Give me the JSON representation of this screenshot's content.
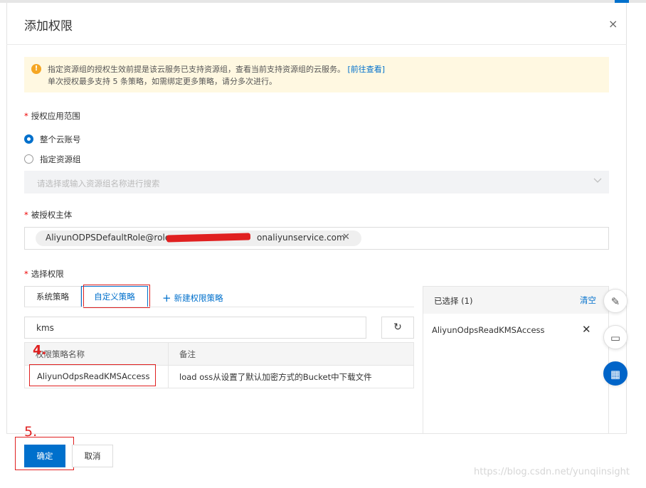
{
  "dialog": {
    "title": "添加权限",
    "close_icon": "×"
  },
  "notice": {
    "line1": "指定资源组的授权生效前提是该云服务已支持资源组，查看当前支持资源组的云服务。",
    "link": "[前往查看]",
    "line2": "单次授权最多支持 5 条策略，如需绑定更多策略，请分多次进行。",
    "icon": "warning-icon",
    "color": "#fff8e1"
  },
  "scope": {
    "required_mark": "*",
    "label": "授权应用范围",
    "options": [
      {
        "label": "整个云账号",
        "checked": true
      },
      {
        "label": "指定资源组",
        "checked": false
      }
    ],
    "resource_group_placeholder": "请选择或输入资源组名称进行搜索"
  },
  "principal": {
    "required_mark": "*",
    "label": "被授权主体",
    "tag_prefix": "AliyunODPSDefaultRole@role.",
    "tag_suffix": "onaliyunservice.com",
    "remove_icon": "✕"
  },
  "permissions": {
    "required_mark": "*",
    "label": "选择权限",
    "tabs": [
      {
        "label": "系统策略",
        "active": false
      },
      {
        "label": "自定义策略",
        "active": true
      }
    ],
    "new_policy_plus": "+",
    "new_policy": "新建权限策略",
    "search_value": "kms",
    "refresh_icon": "↻",
    "table": {
      "headers": [
        "权限策略名称",
        "备注"
      ],
      "rows": [
        [
          "AliyunOdpsReadKMSAccess",
          "load oss从设置了默认加密方式的Bucket中下载文件"
        ]
      ]
    }
  },
  "selected": {
    "title": "已选择 (1)",
    "clear": "清空",
    "items": [
      "AliyunOdpsReadKMSAccess"
    ],
    "remove_icon": "✕"
  },
  "annotations": {
    "step4": "4.",
    "step5": "5.",
    "color": "#e02020"
  },
  "float_buttons": [
    {
      "icon": "edit-note-icon",
      "glyph": "✎"
    },
    {
      "icon": "chat-icon",
      "glyph": "▭"
    },
    {
      "icon": "apps-icon",
      "glyph": "▦"
    }
  ],
  "footer": {
    "confirm": "确定",
    "cancel": "取消"
  },
  "watermark": "https://blog.csdn.net/yunqiinsight",
  "colors": {
    "primary": "#0070cc",
    "danger": "#e02020"
  }
}
